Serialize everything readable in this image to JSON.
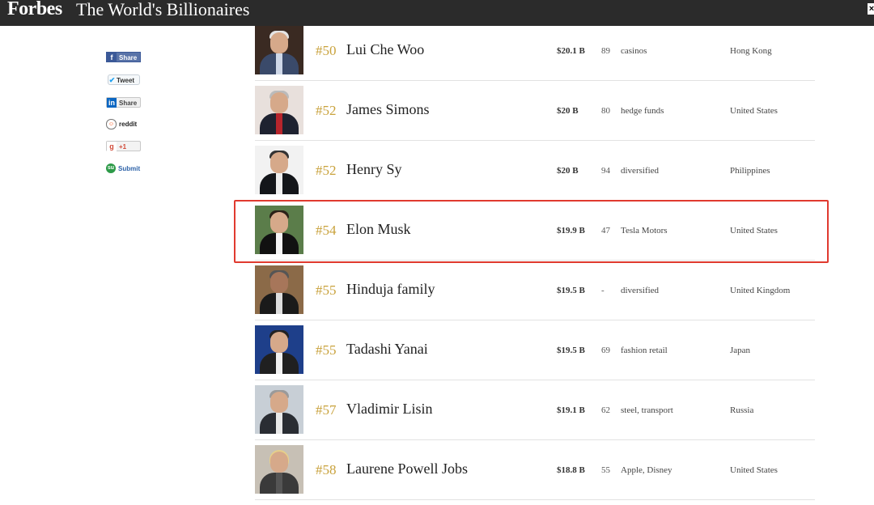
{
  "header": {
    "brand": "Forbes",
    "title": "The World's Billionaires",
    "close_label": "×"
  },
  "social": {
    "facebook": {
      "icon": "f",
      "label": "Share"
    },
    "twitter": {
      "icon": "✔",
      "label": "Tweet"
    },
    "linkedin": {
      "icon": "in",
      "label": "Share"
    },
    "reddit": {
      "icon": "☺",
      "label": "reddit"
    },
    "googleplus": {
      "icon": "g",
      "label": "+1"
    },
    "stumbleupon": {
      "icon": "su",
      "label": "Submit"
    }
  },
  "billionaires": [
    {
      "rank": "#50",
      "name": "Lui Che Woo",
      "net_worth": "$20.1 B",
      "age": "89",
      "source": "casinos",
      "country": "Hong Kong"
    },
    {
      "rank": "#52",
      "name": "James Simons",
      "net_worth": "$20 B",
      "age": "80",
      "source": "hedge funds",
      "country": "United States"
    },
    {
      "rank": "#52",
      "name": "Henry Sy",
      "net_worth": "$20 B",
      "age": "94",
      "source": "diversified",
      "country": "Philippines"
    },
    {
      "rank": "#54",
      "name": "Elon Musk",
      "net_worth": "$19.9 B",
      "age": "47",
      "source": "Tesla Motors",
      "country": "United States"
    },
    {
      "rank": "#55",
      "name": "Hinduja family",
      "net_worth": "$19.5 B",
      "age": "-",
      "source": "diversified",
      "country": "United Kingdom"
    },
    {
      "rank": "#55",
      "name": "Tadashi Yanai",
      "net_worth": "$19.5 B",
      "age": "69",
      "source": "fashion retail",
      "country": "Japan"
    },
    {
      "rank": "#57",
      "name": "Vladimir Lisin",
      "net_worth": "$19.1 B",
      "age": "62",
      "source": "steel, transport",
      "country": "Russia"
    },
    {
      "rank": "#58",
      "name": "Laurene Powell Jobs",
      "net_worth": "$18.8 B",
      "age": "55",
      "source": "Apple, Disney",
      "country": "United States"
    }
  ],
  "highlighted_entry": "Elon Musk",
  "colors": {
    "header_bg": "#2b2b2b",
    "rank": "#c9a23c",
    "highlight_border": "#e03a2f"
  }
}
